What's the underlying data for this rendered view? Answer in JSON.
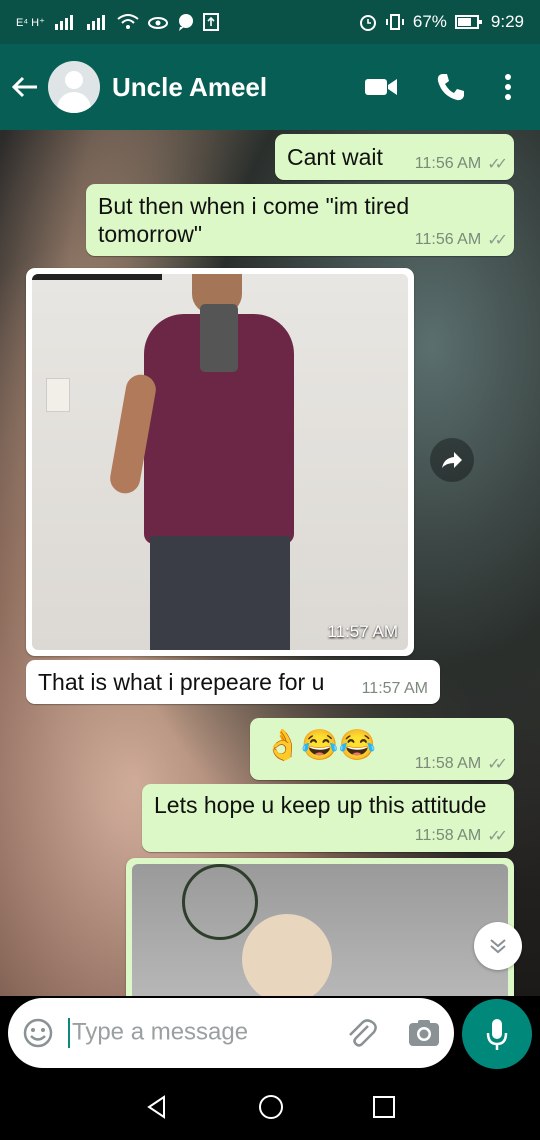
{
  "status_bar": {
    "network": "E⁴ H⁺",
    "battery": "67%",
    "time": "9:29"
  },
  "header": {
    "contact_name": "Uncle Ameel"
  },
  "messages": [
    {
      "dir": "out",
      "text": "Cant wait",
      "time": "11:56 AM",
      "ticks": "✓✓"
    },
    {
      "dir": "out",
      "text": "But then when i come \"im tired tomorrow\"",
      "time": "11:56 AM",
      "ticks": "✓✓"
    },
    {
      "dir": "in",
      "type": "image",
      "time": "11:57 AM"
    },
    {
      "dir": "in",
      "text": "That is what i prepeare for u",
      "time": "11:57 AM"
    },
    {
      "dir": "out",
      "text": "👌😂😂",
      "time": "11:58 AM",
      "ticks": "✓✓"
    },
    {
      "dir": "out",
      "text": "Lets hope u keep up this attitude",
      "time": "11:58 AM",
      "ticks": "✓✓"
    },
    {
      "dir": "out",
      "type": "image"
    }
  ],
  "composer": {
    "placeholder": "Type a message"
  },
  "icons": [
    "back-arrow-icon",
    "avatar",
    "video-call-icon",
    "phone-icon",
    "more-vert-icon",
    "forward-icon",
    "scroll-down-icon",
    "emoji-icon",
    "attach-icon",
    "camera-icon",
    "mic-icon",
    "nav-back-icon",
    "nav-home-icon",
    "nav-recents-icon"
  ],
  "colors": {
    "header": "#075e54",
    "outgoing_bubble": "#dcf8c6",
    "incoming_bubble": "#ffffff",
    "mic_button": "#00897b"
  }
}
